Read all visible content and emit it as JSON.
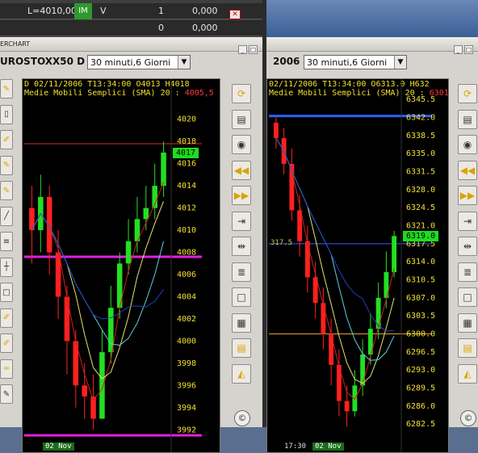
{
  "order_panel": {
    "row1": {
      "qty_label": "L=4010,000",
      "badge": "IM",
      "side": "V",
      "count": "1",
      "price": "0,000",
      "close": "✕"
    },
    "row2": {
      "count": "0",
      "price": "0,000"
    }
  },
  "left_window": {
    "title": "ERCHART",
    "symbol": "UROSTOXX50 D",
    "timeframe": "30 minuti,6 Giorni",
    "header_line1": "D 02/11/2006  T13:34:00  O4013 H4018",
    "header_line2": {
      "text": "Medie Mobili Semplici (SMA)   20 : ",
      "value": "4005,5"
    },
    "last_price": "4017",
    "date_label": "02 Nov",
    "y_ticks": [
      "4020",
      "4018",
      "4016",
      "4014",
      "4012",
      "4010",
      "4008",
      "4006",
      "4004",
      "4002",
      "4000",
      "3998",
      "3996",
      "3994",
      "3992"
    ]
  },
  "right_window": {
    "symbol": "2006",
    "timeframe": "30 minuti,6 Giorni",
    "header_line1": "02/11/2006  T13:34:00  O6313.0 H632",
    "header_line2": {
      "text": "Medie Mobili Semplici (SMA)   20 : ",
      "value": "6301"
    },
    "last_price": "6319.0",
    "time_label": "17:30",
    "date_label": "02 Nov",
    "marker_label": "317.5",
    "y_ticks": [
      "6345.5",
      "6342.0",
      "6338.5",
      "6335.0",
      "6331.5",
      "6328.0",
      "6324.5",
      "6321.0",
      "6317.5",
      "6314.0",
      "6310.5",
      "6307.0",
      "6303.5",
      "6300.0",
      "6296.5",
      "6293.0",
      "6289.5",
      "6286.0",
      "6282.5"
    ]
  },
  "toolbar_icons": [
    "refresh-icon",
    "save-icon",
    "camera-icon",
    "rewind-icon",
    "fast-forward-icon",
    "compress-icon",
    "expand-icon",
    "indicator-icon",
    "window-icon",
    "grid-icon",
    "table-icon",
    "cursor-icon"
  ],
  "toolbar_glyphs": [
    "⟳",
    "💾",
    "📷",
    "◀◀",
    "▶▶",
    "→|←",
    "|↔|",
    "≡",
    "□",
    "▦",
    "▤",
    "◭"
  ],
  "chart_data": [
    {
      "type": "candlestick",
      "title": "UROSTOXX50 D",
      "ylim": [
        3991,
        4021
      ],
      "x": [
        "02 Nov"
      ],
      "closes": [
        4010,
        4013,
        4008,
        4004,
        4000,
        3996,
        3995,
        3993,
        3999,
        4003,
        4007,
        4009,
        4011,
        4012,
        4014,
        4017
      ],
      "opens": [
        4012,
        4010,
        4013,
        4008,
        4004,
        4000,
        3996,
        3995,
        3993,
        3999,
        4003,
        4007,
        4009,
        4011,
        4012,
        4014
      ],
      "highs": [
        4014,
        4015,
        4014,
        4010,
        4005,
        4001,
        3998,
        3997,
        4001,
        4005,
        4008,
        4011,
        4013,
        4014,
        4016,
        4018
      ],
      "lows": [
        4007,
        4008,
        4006,
        4002,
        3997,
        3994,
        3993,
        3992,
        3993,
        3998,
        4002,
        4006,
        4008,
        4010,
        4011,
        4013
      ],
      "hlines": [
        {
          "value": 4017.8,
          "color": "#d03030"
        },
        {
          "value": 4007.6,
          "color": "#e020e0"
        },
        {
          "value": 3991.5,
          "color": "#e020e0"
        }
      ]
    },
    {
      "type": "candlestick",
      "title": "2006",
      "ylim": [
        6280.5,
        6346
      ],
      "x": [
        "17:30",
        "02 Nov"
      ],
      "closes": [
        6338,
        6333,
        6324,
        6318,
        6311,
        6306,
        6300,
        6294,
        6287,
        6285,
        6290,
        6296,
        6301,
        6307,
        6312,
        6319
      ],
      "opens": [
        6341,
        6338,
        6333,
        6324,
        6318,
        6311,
        6306,
        6300,
        6294,
        6287,
        6285,
        6290,
        6296,
        6301,
        6307,
        6312
      ],
      "highs": [
        6342,
        6340,
        6336,
        6327,
        6321,
        6314,
        6309,
        6303,
        6297,
        6290,
        6293,
        6299,
        6304,
        6310,
        6316,
        6320
      ],
      "lows": [
        6336,
        6331,
        6322,
        6315,
        6308,
        6303,
        6297,
        6290,
        6284,
        6282,
        6284,
        6288,
        6294,
        6299,
        6305,
        6311
      ],
      "hlines": [
        {
          "value": 6342.3,
          "color": "#3060ff"
        },
        {
          "value": 6317.5,
          "color": "#3060ff"
        },
        {
          "value": 6300.0,
          "color": "#e8a030"
        }
      ]
    }
  ]
}
